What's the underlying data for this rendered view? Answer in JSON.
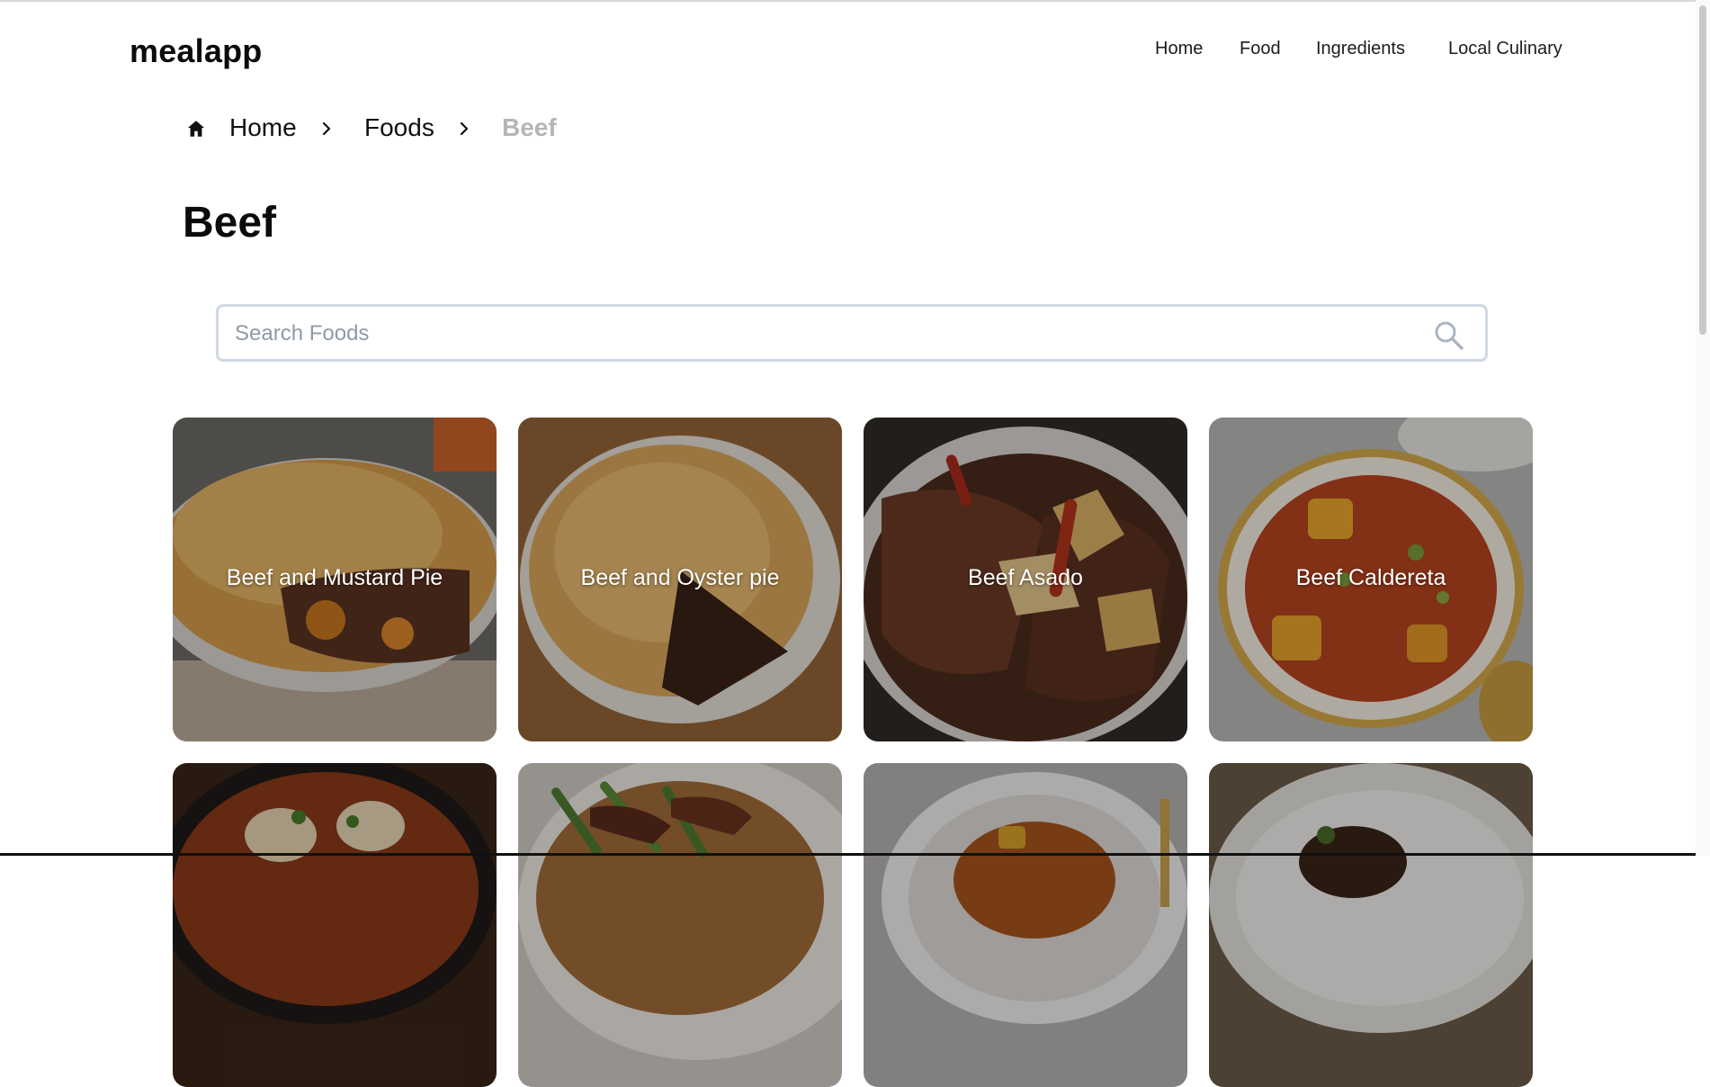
{
  "header": {
    "logo": "mealapp",
    "nav": [
      {
        "label": "Home"
      },
      {
        "label": "Food"
      },
      {
        "label": "Ingredients"
      },
      {
        "label": "Local Culinary"
      }
    ]
  },
  "breadcrumb": {
    "items": [
      {
        "label": "Home"
      },
      {
        "label": "Foods"
      },
      {
        "label": "Beef"
      }
    ],
    "icons": {
      "home": "home-icon",
      "separator": "chevron-right-icon"
    }
  },
  "page": {
    "title": "Beef"
  },
  "search": {
    "placeholder": "Search Foods",
    "value": "",
    "icon": "search-icon"
  },
  "foods": [
    {
      "name": "Beef and Mustard Pie"
    },
    {
      "name": "Beef and Oyster pie"
    },
    {
      "name": "Beef Asado"
    },
    {
      "name": "Beef Caldereta"
    },
    {
      "name": ""
    },
    {
      "name": ""
    },
    {
      "name": ""
    },
    {
      "name": ""
    }
  ],
  "colors": {
    "breadcrumb_active": "#b5b5b5",
    "search_border": "#cfd8e3",
    "search_placeholder": "#8f9aa8",
    "card_overlay": "#00000047"
  }
}
